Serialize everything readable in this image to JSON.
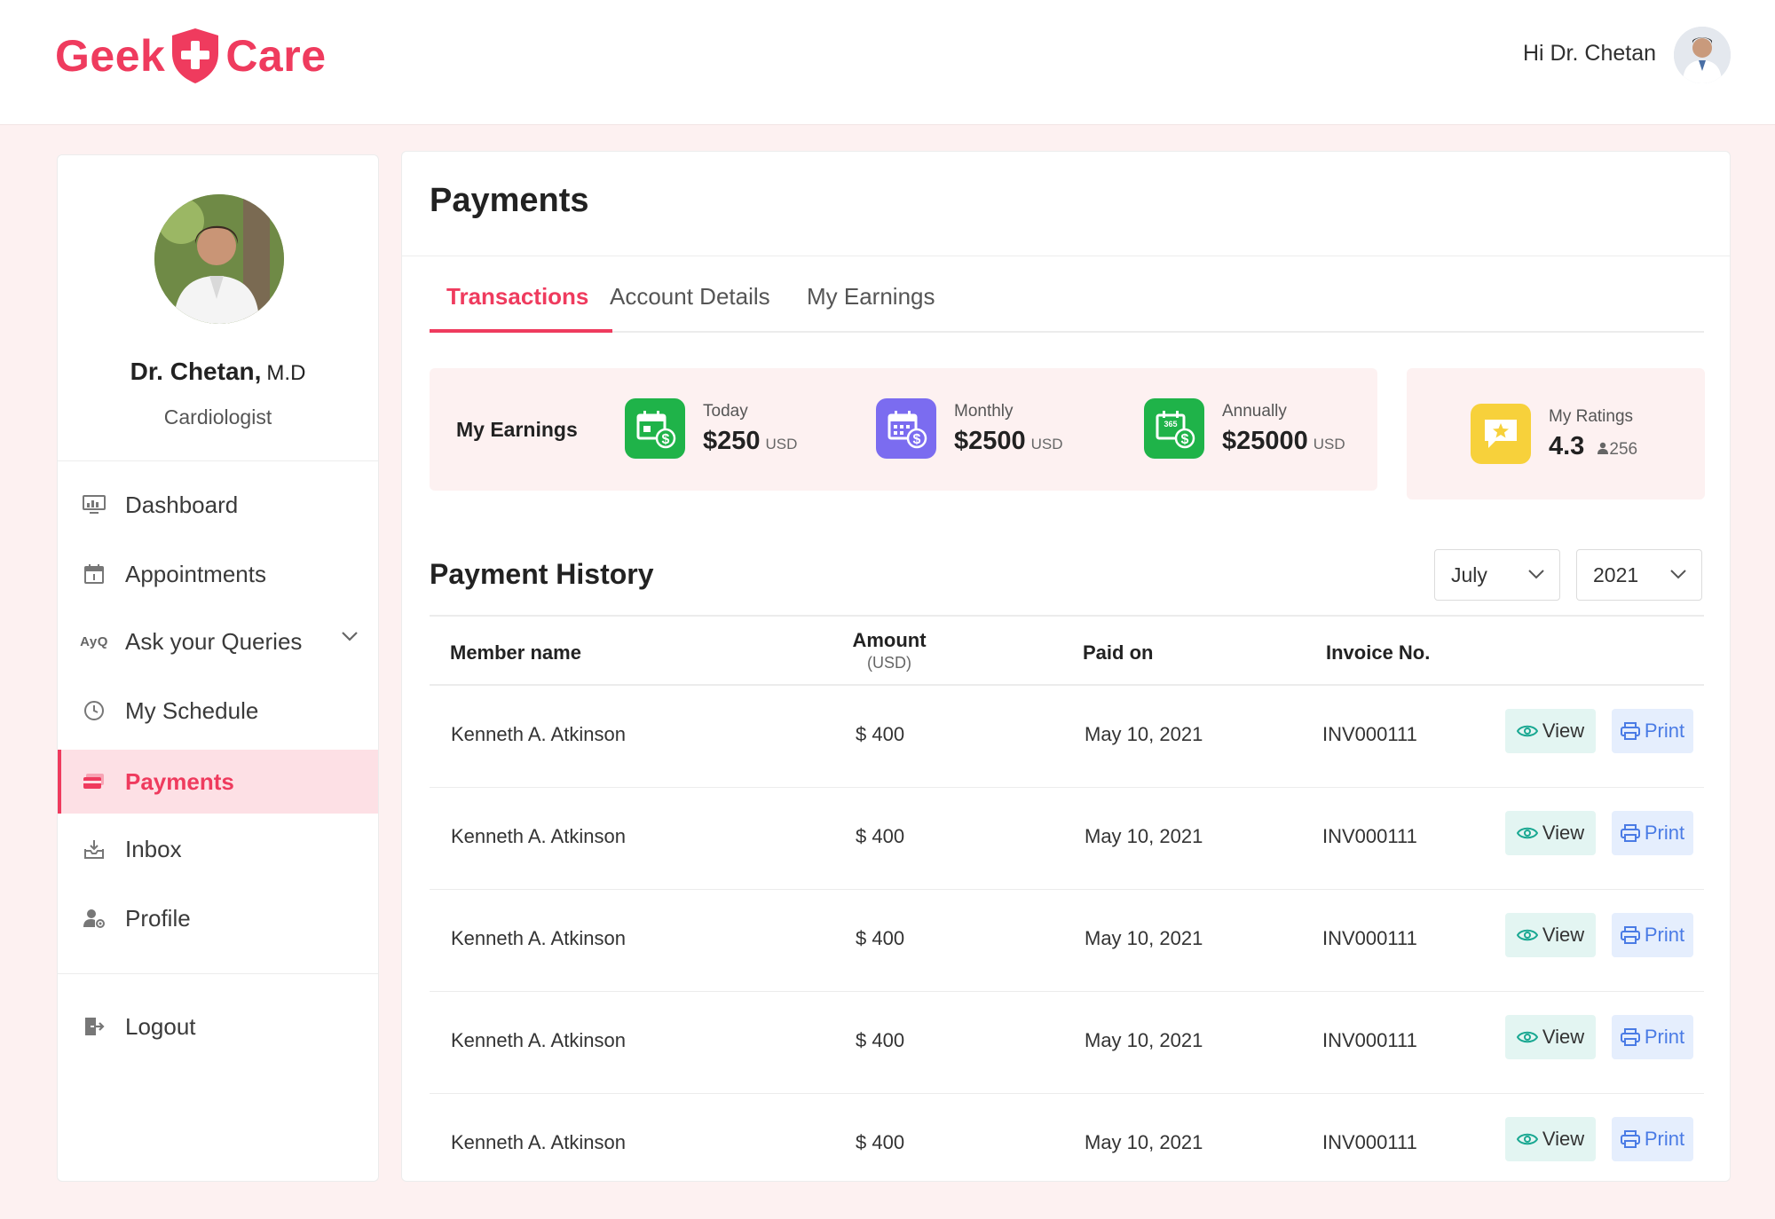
{
  "brand": {
    "left_text": "Geek",
    "right_text": "Care",
    "primary_color": "#ef3b5e"
  },
  "header": {
    "greeting": "Hi Dr. Chetan"
  },
  "sidebar": {
    "doctor_name": "Dr. Chetan,",
    "doctor_suffix": "M.D",
    "doctor_role": "Cardiologist",
    "items": [
      {
        "label": "Dashboard",
        "icon": "dashboard-icon"
      },
      {
        "label": "Appointments",
        "icon": "calendar-icon"
      },
      {
        "label": "Ask your Queries",
        "icon": "ayq-icon",
        "icon_text": "AyQ"
      },
      {
        "label": "My Schedule",
        "icon": "clock-icon"
      },
      {
        "label": "Payments",
        "icon": "card-icon",
        "active": true
      },
      {
        "label": "Inbox",
        "icon": "inbox-icon"
      },
      {
        "label": "Profile",
        "icon": "profile-settings-icon"
      }
    ],
    "logout_label": "Logout"
  },
  "main": {
    "title": "Payments",
    "tabs": [
      {
        "label": "Transactions",
        "active": true
      },
      {
        "label": "Account Details"
      },
      {
        "label": "My Earnings"
      }
    ],
    "earnings": {
      "label": "My Earnings",
      "stats": [
        {
          "label": "Today",
          "value": "$250",
          "unit": "USD",
          "color": "#1fb349",
          "icon": "calendar-dollar-icon"
        },
        {
          "label": "Monthly",
          "value": "$2500",
          "unit": "USD",
          "color": "#7b6cf0",
          "icon": "calendar-grid-dollar-icon"
        },
        {
          "label": "Annually",
          "value": "$25000",
          "unit": "USD",
          "color": "#1fb349",
          "icon": "calendar-365-dollar-icon",
          "badge": "365"
        }
      ]
    },
    "ratings": {
      "label": "My Ratings",
      "value": "4.3",
      "count": "256",
      "color": "#f7d13b"
    },
    "history": {
      "title": "Payment History",
      "month": "July",
      "year": "2021",
      "columns": {
        "member": "Member name",
        "amount": "Amount",
        "amount_unit": "(USD)",
        "paid_on": "Paid on",
        "invoice": "Invoice No."
      },
      "view_label": "View",
      "print_label": "Print",
      "rows": [
        {
          "member": "Kenneth A. Atkinson",
          "amount": "$ 400",
          "paid_on": "May 10, 2021",
          "invoice": "INV000111"
        },
        {
          "member": "Kenneth A. Atkinson",
          "amount": "$ 400",
          "paid_on": "May 10, 2021",
          "invoice": "INV000111"
        },
        {
          "member": "Kenneth A. Atkinson",
          "amount": "$ 400",
          "paid_on": "May 10, 2021",
          "invoice": "INV000111"
        },
        {
          "member": "Kenneth A. Atkinson",
          "amount": "$ 400",
          "paid_on": "May 10, 2021",
          "invoice": "INV000111"
        },
        {
          "member": "Kenneth A. Atkinson",
          "amount": "$ 400",
          "paid_on": "May 10, 2021",
          "invoice": "INV000111"
        }
      ]
    }
  }
}
